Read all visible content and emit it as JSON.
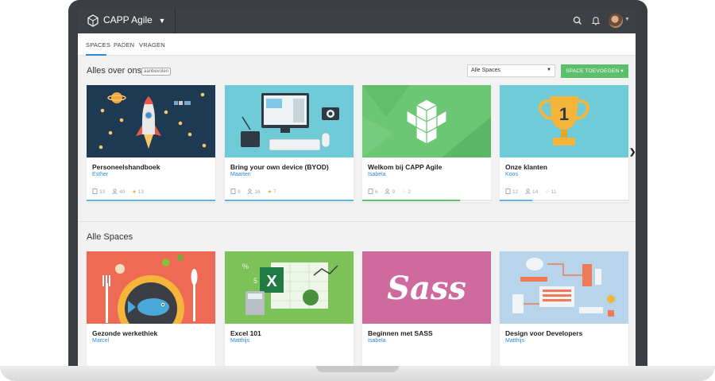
{
  "app": {
    "title": "CAPP Agile"
  },
  "tabs": [
    {
      "label": "SPACES",
      "active": true
    },
    {
      "label": "PADEN",
      "active": false
    },
    {
      "label": "VRAGEN",
      "active": false
    }
  ],
  "featured": {
    "title": "Alles over ons",
    "badge": "aanbevolen",
    "filter_value": "Alle Spaces",
    "add_button": "SPACE TOEVOEGEN",
    "cards": [
      {
        "title": "Personeelshandboek",
        "author": "Esther",
        "pages": "33",
        "users": "40",
        "stars": "13",
        "progress": 1.0,
        "starred": true
      },
      {
        "title": "Bring your own device (BYOD)",
        "author": "Maarten",
        "pages": "9",
        "users": "16",
        "stars": "7",
        "progress": 1.0,
        "starred": true
      },
      {
        "title": "Welkom bij CAPP Agile",
        "author": "Isabela",
        "pages": "6",
        "users": "9",
        "stars": "2",
        "progress": 0.76,
        "starred": false
      },
      {
        "title": "Onze klanten",
        "author": "Koos",
        "pages": "12",
        "users": "14",
        "stars": "11",
        "progress": 0.25,
        "starred": false
      }
    ]
  },
  "all_spaces": {
    "title": "Alle Spaces",
    "cards": [
      {
        "title": "Gezonde werkethiek",
        "author": "Marcel"
      },
      {
        "title": "Excel 101",
        "author": "Matthijs"
      },
      {
        "title": "Beginnen met SASS",
        "author": "Isabela"
      },
      {
        "title": "Design voor Developers",
        "author": "Matthijs"
      }
    ]
  },
  "colors": {
    "accent": "#2b8ad8",
    "green": "#5cc06a",
    "topbar": "#3d4045",
    "card_space": "#1e3a52",
    "card_byod": "#6fcbd8",
    "card_welcome": "#6cc775",
    "card_clients": "#6fcbd8",
    "card_food": "#ee6a55",
    "card_excel": "#7cc259",
    "card_sass": "#cf6a9e",
    "card_design": "#b7d4ea"
  },
  "icons": {
    "logo": "cube-icon",
    "search": "search-icon",
    "bell": "bell-icon",
    "next": "chevron-right-icon"
  }
}
